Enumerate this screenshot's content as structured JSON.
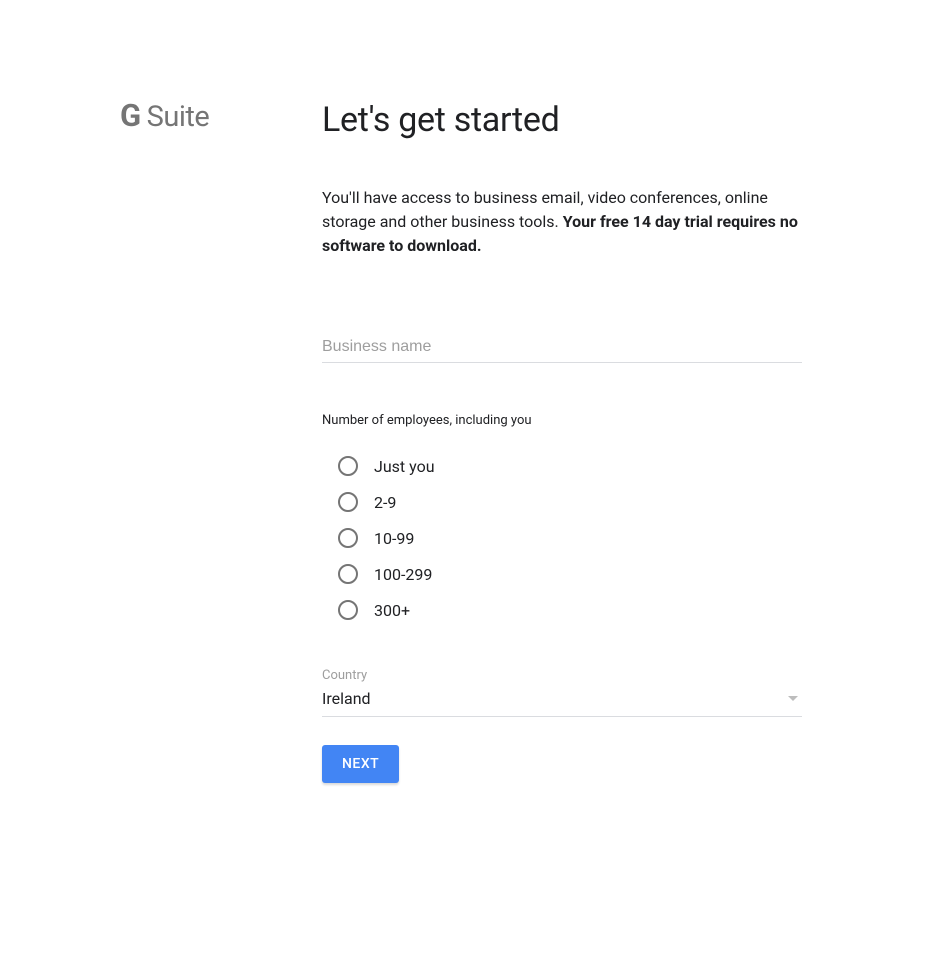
{
  "logo": {
    "g": "G",
    "suite": "Suite"
  },
  "heading": "Let's get started",
  "description": {
    "text": "You'll have access to business email, video conferences, online storage and other business tools. ",
    "bold": "Your free 14 day trial requires no software to download."
  },
  "business_name": {
    "placeholder": "Business name",
    "value": ""
  },
  "employees": {
    "label": "Number of employees, including you",
    "options": [
      "Just you",
      "2-9",
      "10-99",
      "100-299",
      "300+"
    ]
  },
  "country": {
    "label": "Country",
    "value": "Ireland"
  },
  "next_button": "NEXT"
}
